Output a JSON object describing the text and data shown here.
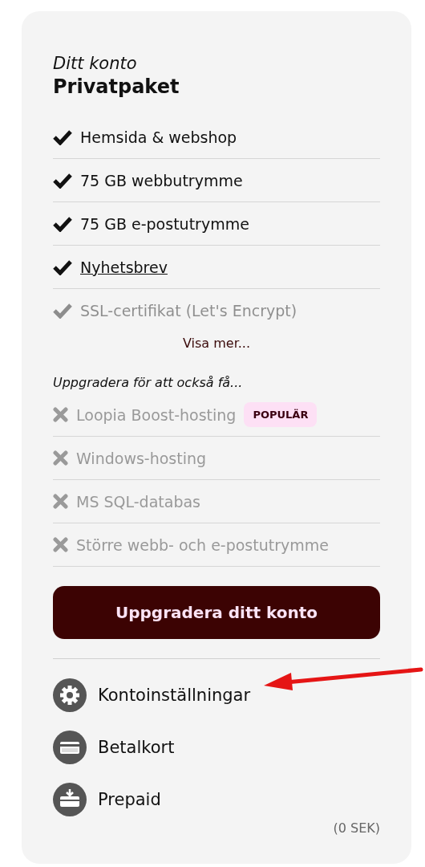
{
  "account": {
    "subtitle": "Ditt konto",
    "title": "Privatpaket"
  },
  "included": [
    {
      "label": "Hemsida & webshop",
      "link": false,
      "faded": false
    },
    {
      "label": "75 GB webbutrymme",
      "link": false,
      "faded": false
    },
    {
      "label": "75 GB e-postutrymme",
      "link": false,
      "faded": false
    },
    {
      "label": "Nyhetsbrev",
      "link": true,
      "faded": false
    },
    {
      "label": "SSL-certifikat (Let's Encrypt)",
      "link": false,
      "faded": true
    }
  ],
  "show_more": "Visa mer...",
  "upgrade_heading": "Uppgradera för att också få...",
  "upgrades": [
    {
      "label": "Loopia Boost-hosting",
      "badge": "POPULÄR"
    },
    {
      "label": "Windows-hosting"
    },
    {
      "label": "MS SQL-databas"
    },
    {
      "label": "Större webb- och e-postutrymme"
    }
  ],
  "upgrade_button": "Uppgradera ditt konto",
  "menu": [
    {
      "kind": "gear",
      "label": "Kontoinställningar"
    },
    {
      "kind": "card",
      "label": "Betalkort"
    },
    {
      "kind": "prepaid",
      "label": "Prepaid"
    }
  ],
  "balance": "(0 SEK)"
}
